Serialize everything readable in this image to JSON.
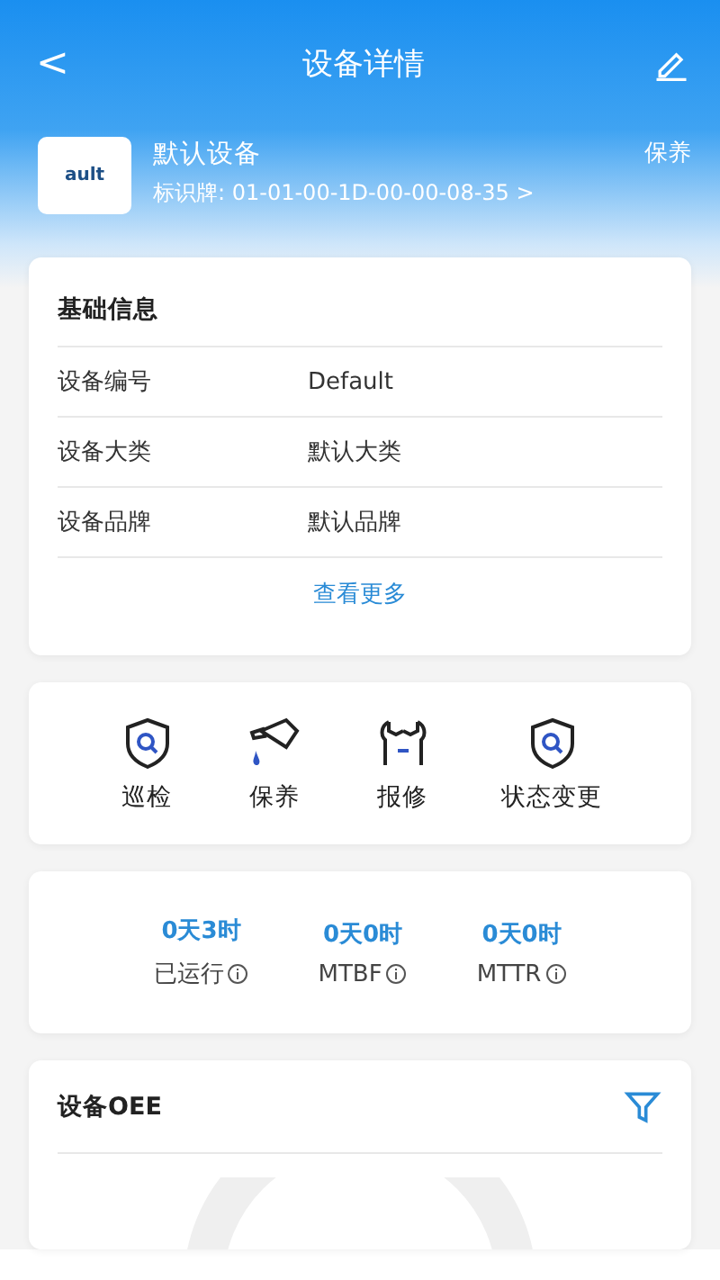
{
  "nav": {
    "back": "<",
    "title": "设备详情"
  },
  "device": {
    "logo_text": "ault",
    "name": "默认设备",
    "tag": "标识牌: 01-01-00-1D-00-00-08-35 >",
    "status": "保养"
  },
  "basic_info": {
    "title": "基础信息",
    "rows": [
      {
        "label": "设备编号",
        "value": "Default"
      },
      {
        "label": "设备大类",
        "value": "默认大类"
      },
      {
        "label": "设备品牌",
        "value": "默认品牌"
      }
    ],
    "more": "查看更多"
  },
  "actions": [
    {
      "kind": "inspect",
      "label": "巡检"
    },
    {
      "kind": "maintain",
      "label": "保养"
    },
    {
      "kind": "repair",
      "label": "报修"
    },
    {
      "kind": "inspect",
      "label": "状态变更"
    }
  ],
  "stats": [
    {
      "value": "0天3时",
      "label": "已运行"
    },
    {
      "value": "0天0时",
      "label": "MTBF"
    },
    {
      "value": "0天0时",
      "label": "MTTR"
    }
  ],
  "oee": {
    "title": "设备OEE"
  }
}
